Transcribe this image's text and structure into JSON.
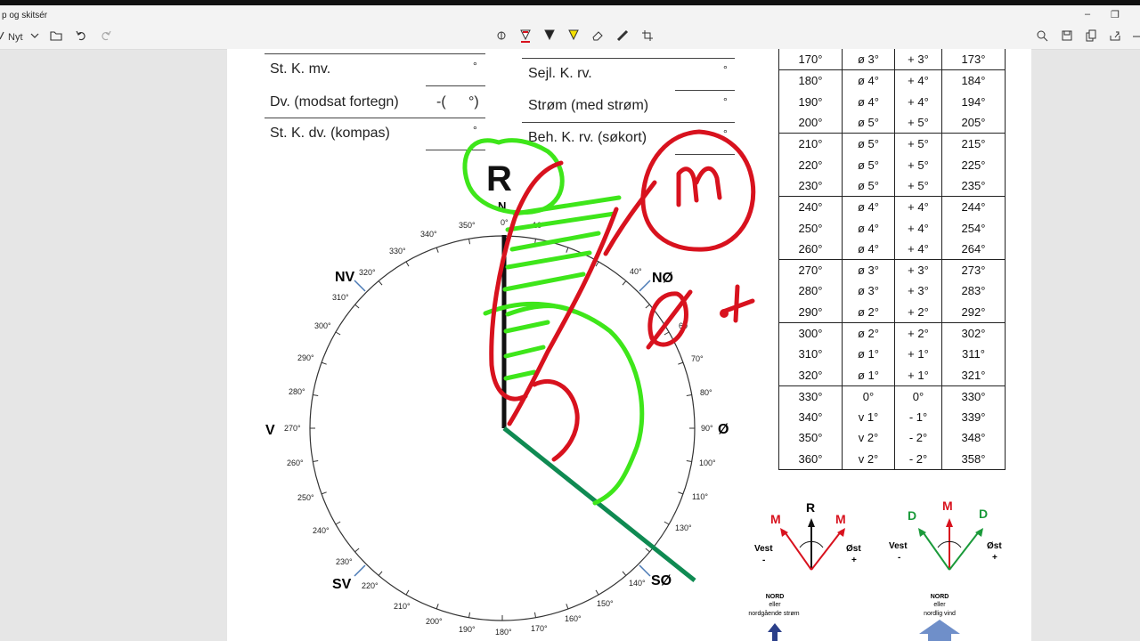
{
  "window": {
    "title": "p og skitsér",
    "minimize": "–",
    "restore": "❐"
  },
  "toolbar": {
    "new_label": "Nyt"
  },
  "form": {
    "st_k_mv": "St. K. mv.",
    "dv_modsat": "Dv. (modsat fortegn)",
    "dv_paren_open": "-(",
    "dv_paren_close": "°)",
    "st_k_dv": "St. K. dv. (kompas)",
    "sejl_k_rv": "Sejl. K. rv.",
    "strom": "Strøm (med strøm)",
    "beh_k_rv": "Beh. K. rv. (søkort)",
    "deg": "°"
  },
  "deviation_table": {
    "rows": [
      [
        "170°",
        "ø 3°",
        "+ 3°",
        "173°"
      ],
      [
        "180°",
        "ø 4°",
        "+ 4°",
        "184°"
      ],
      [
        "190°",
        "ø 4°",
        "+ 4°",
        "194°"
      ],
      [
        "200°",
        "ø 5°",
        "+ 5°",
        "205°"
      ],
      [
        "210°",
        "ø 5°",
        "+ 5°",
        "215°"
      ],
      [
        "220°",
        "ø 5°",
        "+ 5°",
        "225°"
      ],
      [
        "230°",
        "ø 5°",
        "+ 5°",
        "235°"
      ],
      [
        "240°",
        "ø 4°",
        "+ 4°",
        "244°"
      ],
      [
        "250°",
        "ø 4°",
        "+ 4°",
        "254°"
      ],
      [
        "260°",
        "ø 4°",
        "+ 4°",
        "264°"
      ],
      [
        "270°",
        "ø 3°",
        "+ 3°",
        "273°"
      ],
      [
        "280°",
        "ø 3°",
        "+ 3°",
        "283°"
      ],
      [
        "290°",
        "ø 2°",
        "+ 2°",
        "292°"
      ],
      [
        "300°",
        "ø 2°",
        "+ 2°",
        "302°"
      ],
      [
        "310°",
        "ø 1°",
        "+ 1°",
        "311°"
      ],
      [
        "320°",
        "ø 1°",
        "+ 1°",
        "321°"
      ],
      [
        "330°",
        "0°",
        "0°",
        "330°"
      ],
      [
        "340°",
        "v 1°",
        "- 1°",
        "339°"
      ],
      [
        "350°",
        "v 2°",
        "- 2°",
        "348°"
      ],
      [
        "360°",
        "v 2°",
        "- 2°",
        "358°"
      ]
    ],
    "group_ends": [
      0,
      3,
      6,
      9,
      12,
      15,
      19
    ]
  },
  "compass": {
    "cardinal": {
      "N": "N",
      "NO": "NØ",
      "O": "Ø",
      "SO": "SØ",
      "SV": "SV",
      "V": "V",
      "NV": "NV"
    },
    "degree_labels": [
      "0°",
      "10°",
      "40°",
      "60",
      "70°",
      "80°",
      "90°",
      "100°",
      "110°",
      "130°",
      "140°",
      "150°",
      "160°",
      "170°",
      "180°",
      "190°",
      "200°",
      "210°",
      "220°",
      "230°",
      "240°",
      "250°",
      "260°",
      "270°",
      "280°",
      "290°",
      "300°",
      "310°",
      "320°",
      "330°",
      "340°",
      "350°"
    ]
  },
  "diagram1": {
    "R": "R",
    "M1": "M",
    "M2": "M",
    "vest": "Vest",
    "ost": "Øst",
    "minus": "-",
    "plus": "+",
    "nord": "NORD",
    "eller": "eller",
    "sub": "nordgående strøm"
  },
  "diagram2": {
    "D1": "D",
    "M": "M",
    "D2": "D",
    "vest": "Vest",
    "ost": "Øst",
    "minus": "-",
    "plus": "+",
    "nord": "NORD",
    "eller": "eller",
    "sub": "nordlig vind"
  },
  "annotations": {
    "R": "R",
    "M": "m",
    "O": "Ø",
    "plus": "+"
  },
  "colors": {
    "red_ink": "#d8121e",
    "green_ink": "#3ee61a",
    "dark_green": "#0f8a52"
  }
}
